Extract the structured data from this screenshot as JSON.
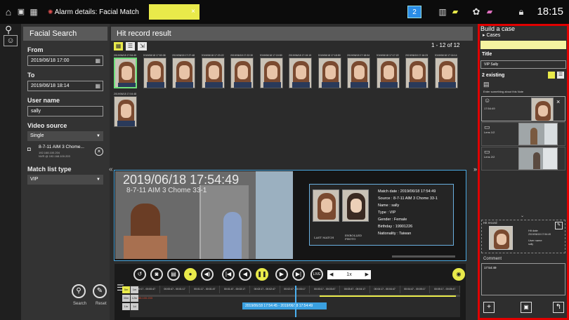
{
  "topbar": {
    "tab_alarm": "Alarm details: Facial Match",
    "tab_close": "×",
    "tab_active": "",
    "badge": "2",
    "time": "18:15"
  },
  "left": {
    "title": "Facial Search",
    "from_label": "From",
    "from_value": "2019/06/18 17:00",
    "to_label": "To",
    "to_value": "2019/06/18 18:14",
    "user_label": "User name",
    "user_value": "sally",
    "source_label": "Video source",
    "source_value": "Single",
    "cam_name": "8-7-11 AIM 3 Chome...",
    "cam_ip": "192.168.100.204",
    "cam_nvr": "NVR @ 192.168.100.203",
    "matchtype_label": "Match list type",
    "matchtype_value": "VIP",
    "search_label": "Search",
    "reset_label": "Reset"
  },
  "main": {
    "title": "Hit record result",
    "page_count": "1 - 12 of 12",
    "thumbs": [
      "2019/06/18 17:54:49",
      "2019/06/18 17:53:38",
      "2019/06/18 17:27:48",
      "2019/06/18 17:23:22",
      "2019/06/18 17:22:30",
      "2019/06/18 17:19:59",
      "2019/06/18 17:19:19",
      "2019/06/18 17:18:59",
      "2019/06/18 17:18:04",
      "2019/06/18 17:17:22",
      "2019/06/18 17:16:23",
      "2019/06/18 17:16:14",
      "2019/06/18 17:04:48"
    ],
    "video_stamp": "2019/06/18 17:54:49",
    "video_sub": "8-7-11 AIM 3 Chome 33-1",
    "last_match": "LAST MATCH",
    "enrolled_photo": "ENROLLED PHOTO",
    "match_date": "Match date : 2019/06/18 17:54:49",
    "source": "Source : 8-7-11 AIM 3 Chome 33-1",
    "name": "Name : sally",
    "type": "Type : VIP",
    "gender": "Gender : Female",
    "birthday": "Birthday : 19901226",
    "nationality": "Nationality : Taiwan",
    "live_label": "LIVE",
    "speed": "1x",
    "timeline_highlight": "2019/06/18 17:54:45 - 2019/06/18 17:54:49",
    "tl_segments": [
      "00:00:17 - 00:00:47",
      "00:00:47 - 00:01:17",
      "00:01:17 - 00:01:47",
      "00:01:47 - 00:02:17",
      "00:02:17 - 00:02:47",
      "00:02:47 - 00:03:17",
      "00:03:17 - 00:03:47",
      "00:03:47 - 00:04:17",
      "00:04:17 - 00:04:47",
      "00:04:47 - 00:05:17",
      "00:05:17 - 00:05:47"
    ],
    "tl_red": "192.168.100.203",
    "zoom_labels": [
      "5m",
      "1m",
      "30m",
      "12hr",
      "1hr",
      "1d"
    ]
  },
  "right": {
    "title": "Build a case",
    "cases_label": "Cases",
    "title_label": "Title",
    "title_value": "VIP Sally",
    "existing_label": "2 existing",
    "note_placeholder": "Enter something about this Note",
    "item1_time": "17:54:49",
    "item2_label": "Lens 1/2",
    "item3_label": "Lens 2/2",
    "hit_record_label": "Hit record",
    "hit_date_label": "Hit date",
    "hit_date_value": "2019/06/18 17:54:49",
    "user_name_label": "User name",
    "user_name_value": "sally",
    "comment_label": "Comment",
    "comment_value": "17:54:49"
  },
  "colors": {
    "accent_yellow": "#e9ea4a",
    "selection_blue": "#4aa8e0",
    "highlight_red": "#e00000",
    "badge_blue": "#2a8de8"
  }
}
